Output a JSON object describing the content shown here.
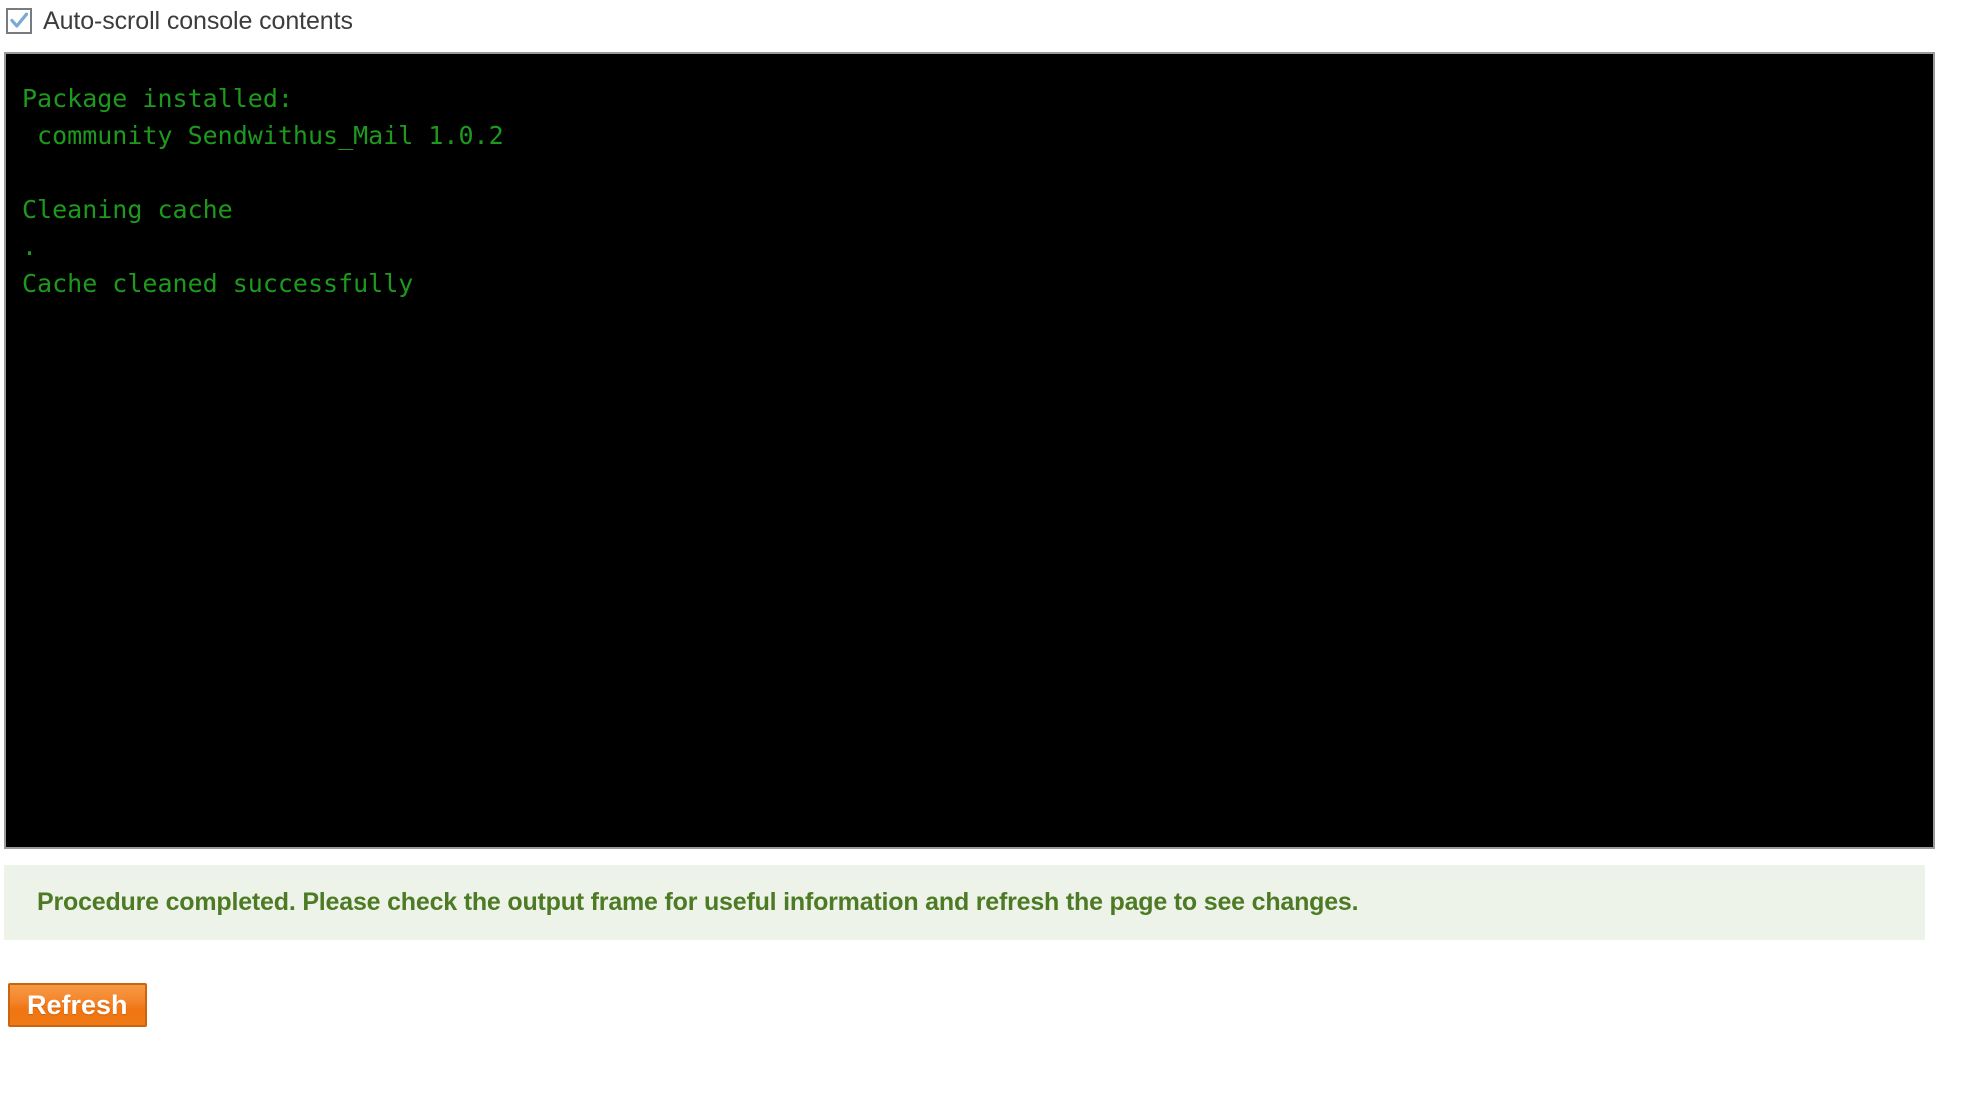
{
  "autoscroll": {
    "label": "Auto-scroll console contents",
    "checked": true,
    "check_color": "#7aa9d4",
    "border_color": "#777c80"
  },
  "console": {
    "name": "output-frame",
    "background": "#000000",
    "text_color": "#1d9a1d",
    "lines": [
      "Package installed:",
      " community Sendwithus_Mail 1.0.2",
      "",
      "Cleaning cache",
      ".",
      "Cache cleaned successfully"
    ],
    "content": "Package installed:\n community Sendwithus_Mail 1.0.2\n\nCleaning cache\n.\nCache cleaned successfully"
  },
  "status": {
    "message": "Procedure completed. Please check the output frame for useful information and refresh the page to see changes.",
    "type": "success",
    "background": "#eef3e9",
    "text_color": "#4d7a24"
  },
  "actions": {
    "refresh_label": "Refresh",
    "refresh_color": "#f4842b",
    "refresh_border": "#c9650f"
  }
}
